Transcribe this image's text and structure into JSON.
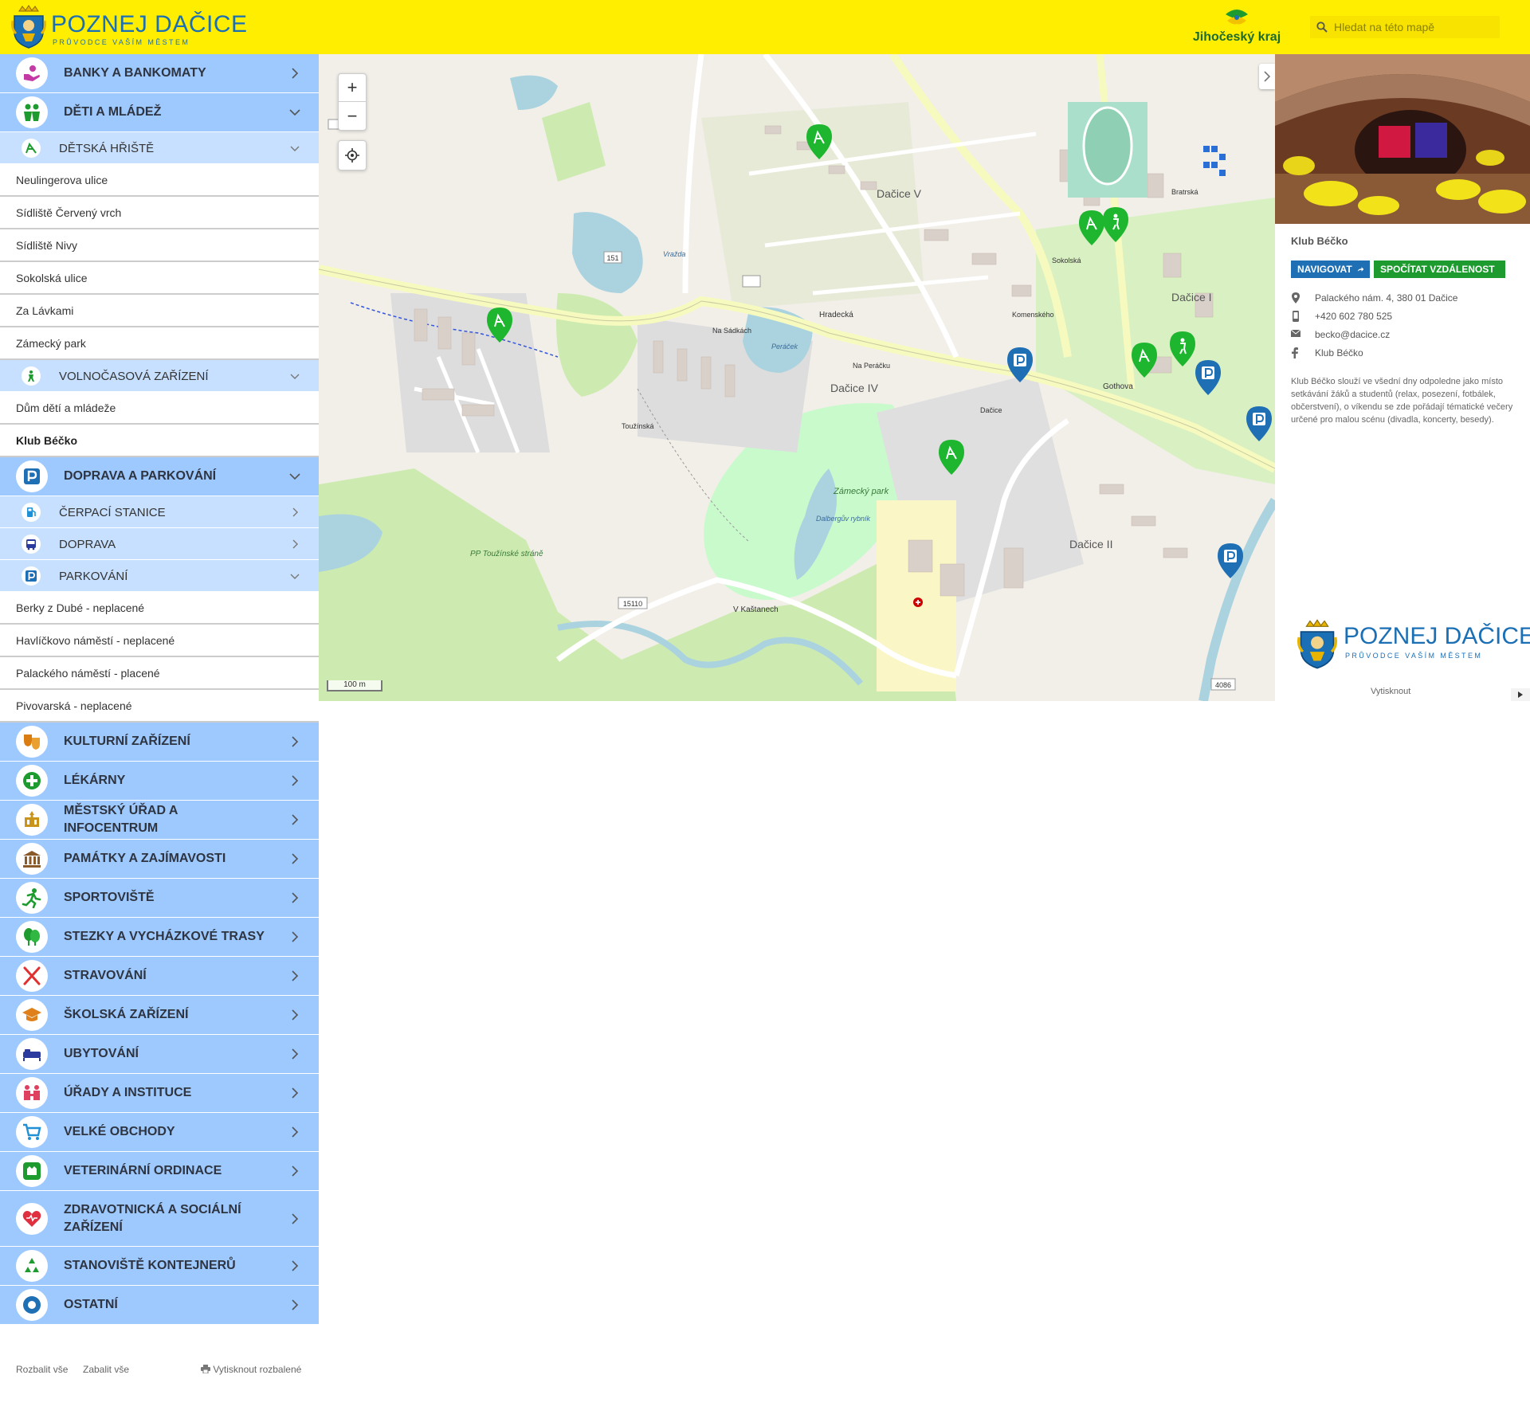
{
  "header": {
    "logo_name": "POZNEJ DAČICE",
    "logo_tagline": "PRŮVODCE VAŠÍM MĚSTEM",
    "region_name": "Jihočeský kraj",
    "search_placeholder": "Hledat na této mapě"
  },
  "sidebar": {
    "categories": [
      {
        "label": "BANKY A BANKOMATY",
        "icon": "bank-hand-icon",
        "color": "#c43aa4",
        "expanded": false
      },
      {
        "label": "DĚTI A MLÁDEŽ",
        "icon": "children-icon",
        "color": "#1e9b2f",
        "expanded": true,
        "subcategories": [
          {
            "label": "DĚTSKÁ HŘIŠTĚ",
            "icon": "playground-icon",
            "expanded": true,
            "items": [
              "Neulingerova ulice",
              "Sídliště Červený vrch",
              "Sídliště Nivy",
              "Sokolská ulice",
              "Za Lávkami",
              "Zámecký park"
            ]
          },
          {
            "label": "VOLNOČASOVÁ ZAŘÍZENÍ",
            "icon": "leisure-icon",
            "expanded": true,
            "items": [
              "Dům dětí a mládeže",
              "Klub Béčko"
            ]
          }
        ]
      },
      {
        "label": "DOPRAVA A PARKOVÁNÍ",
        "icon": "parking-icon",
        "color": "#1f6fb5",
        "expanded": true,
        "subcategories": [
          {
            "label": "ČERPACÍ STANICE",
            "icon": "fuel-icon",
            "expanded": false
          },
          {
            "label": "DOPRAVA",
            "icon": "bus-icon",
            "expanded": false
          },
          {
            "label": "PARKOVÁNÍ",
            "icon": "parking-small-icon",
            "expanded": true,
            "items": [
              "Berky z Dubé - neplacené",
              "Havlíčkovo náměstí - neplacené",
              "Palackého náměstí - placené",
              "Pivovarská - neplacené"
            ]
          }
        ]
      },
      {
        "label": "KULTURNÍ ZAŘÍZENÍ",
        "icon": "theatre-masks-icon",
        "color": "#d97c12"
      },
      {
        "label": "LÉKÁRNY",
        "icon": "pharmacy-icon",
        "color": "#1e9b2f"
      },
      {
        "label": "MĚSTSKÝ ÚŘAD A INFOCENTRUM",
        "icon": "townhall-icon",
        "color": "#c8941a"
      },
      {
        "label": "PAMÁTKY A ZAJÍMAVOSTI",
        "icon": "monument-icon",
        "color": "#8a5a2b"
      },
      {
        "label": "SPORTOVIŠTĚ",
        "icon": "running-icon",
        "color": "#1e9b2f"
      },
      {
        "label": "STEZKY A VYCHÁZKOVÉ TRASY",
        "icon": "trees-icon",
        "color": "#1e9b2f"
      },
      {
        "label": "STRAVOVÁNÍ",
        "icon": "cutlery-icon",
        "color": "#e03030"
      },
      {
        "label": "ŠKOLSKÁ ZAŘÍZENÍ",
        "icon": "graduation-cap-icon",
        "color": "#e0801a"
      },
      {
        "label": "UBYTOVÁNÍ",
        "icon": "bed-icon",
        "color": "#2a3a9e"
      },
      {
        "label": "ÚŘADY A INSTITUCE",
        "icon": "institution-icon",
        "color": "#e04060"
      },
      {
        "label": "VELKÉ OBCHODY",
        "icon": "shopping-cart-icon",
        "color": "#1f8fd6"
      },
      {
        "label": "VETERINÁRNÍ ORDINACE",
        "icon": "veterinary-icon",
        "color": "#1e9b2f"
      },
      {
        "label": "ZDRAVOTNICKÁ A SOCIÁLNÍ ZAŘÍZENÍ",
        "icon": "heart-icon",
        "color": "#e03040"
      },
      {
        "label": "STANOVIŠTĚ KONTEJNERŮ",
        "icon": "recycle-icon",
        "color": "#1e9b2f"
      },
      {
        "label": "OSTATNÍ",
        "icon": "circle-icon",
        "color": "#1f6fb5"
      }
    ],
    "active_item": "Klub Béčko",
    "footer": {
      "expand_all": "Rozbalit vše",
      "collapse_all": "Zabalit vše",
      "print_expanded": "Vytisknout rozbalené"
    }
  },
  "map": {
    "zoom_in": "+",
    "zoom_out": "−",
    "scale_label": "100 m",
    "labels": {
      "district_v": "Dačice V",
      "district_i": "Dačice I",
      "district_iv": "Dačice IV",
      "district_ii": "Dačice II",
      "park": "Zámecký park",
      "pond": "Dalbergův rybník",
      "pond2": "Peráček",
      "pond3": "Vražda",
      "nature": "PP Toužínské stráně",
      "road_151": "151",
      "road_15110": "15110",
      "road_4086": "4086",
      "street_hradecka": "Hradecká",
      "street_gothova": "Gothova",
      "street_kastanech": "V Kaštanech",
      "street_touzinska": "Toužínská",
      "street_sokolska": "Sokolská",
      "street_bratrska": "Bratrská",
      "street_komenskeho": "Komenského",
      "street_na_sadkach": "Na Sádkách",
      "street_peracek": "Na Peráčku",
      "town": "Dačice"
    }
  },
  "detail": {
    "title": "Klub Béčko",
    "navigate_label": "NAVIGOVAT",
    "distance_label": "SPOČÍTAT VZDÁLENOST",
    "address": "Palackého nám. 4, 380 01 Dačice",
    "phone": "+420 602 780 525",
    "email": "becko@dacice.cz",
    "facebook": "Klub Béčko",
    "description": "Klub Béčko slouží ve všední dny odpoledne jako místo setkávání žáků a studentů (relax, posezení, fotbálek, občerstvení), o víkendu se zde pořádají tématické večery určené pro malou scénu (divadla, koncerty, besedy).",
    "print_label": "Vytisknout",
    "logo_name": "POZNEJ DAČICE",
    "logo_tagline": "PRŮVODCE VAŠÍM MĚSTEM"
  },
  "colors": {
    "header": "#ffee00",
    "category": "#9ec9ff",
    "subcategory": "#c7e0ff",
    "brand_blue": "#1b6fb5",
    "navigate_button": "#1f6fb5",
    "distance_button": "#1e9b2f",
    "marker_green": "#1eb52f",
    "marker_blue": "#1f6fb5"
  }
}
